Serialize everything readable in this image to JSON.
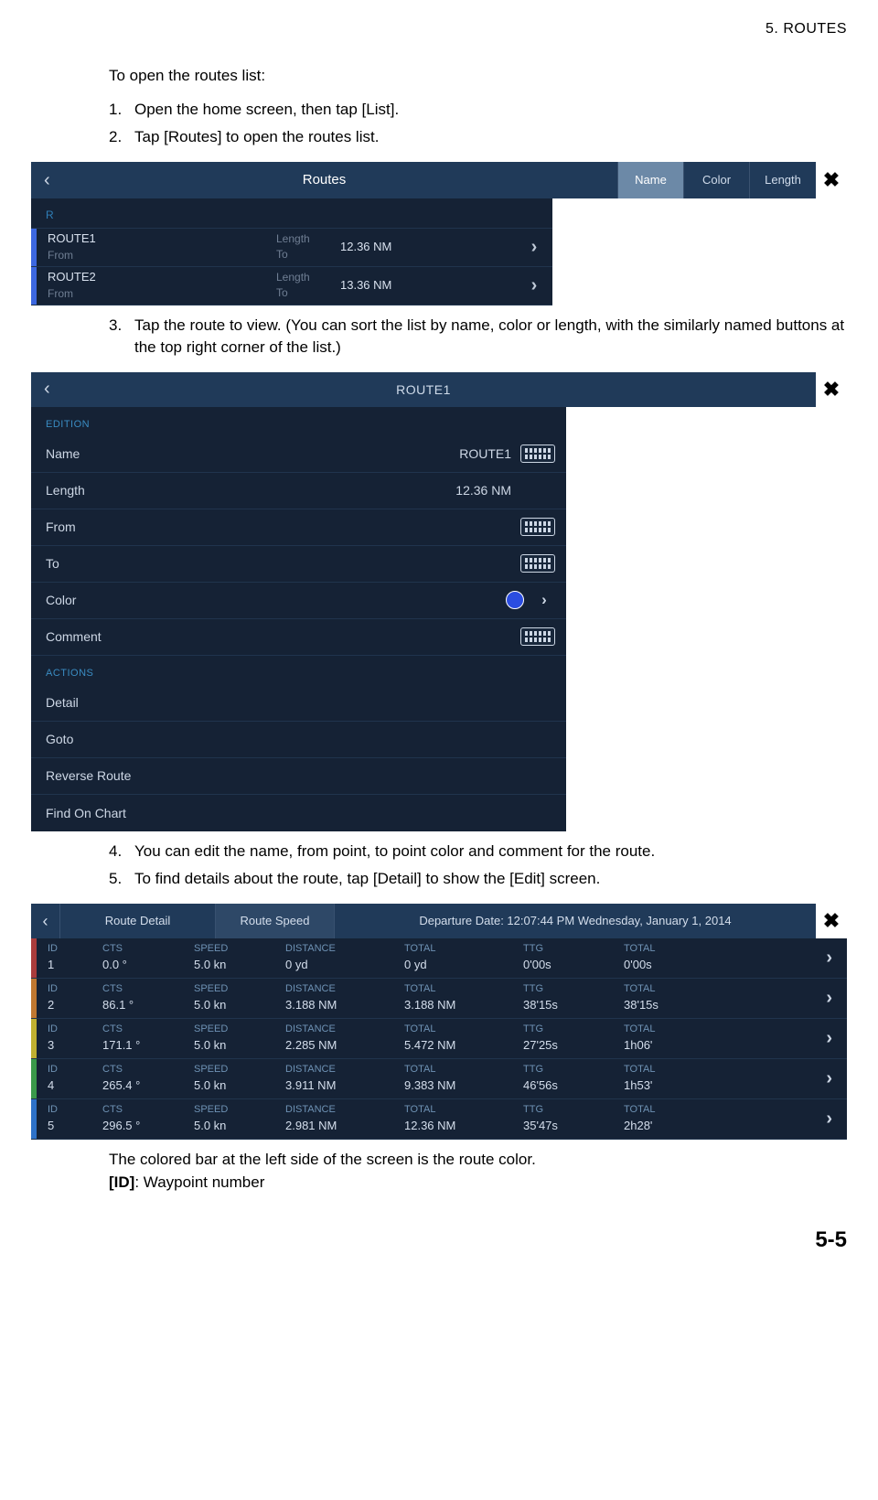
{
  "chapter_header": "5.  ROUTES",
  "intro": "To open the routes list:",
  "step1": "Open the home screen, then tap [List].",
  "step2": "Tap [Routes] to open the routes list.",
  "step3": "Tap the route to view. (You can sort the list by name, color or length, with the similarly named buttons at the top right corner of the list.)",
  "step4": "You can edit the name, from point, to point color and comment for the route.",
  "step5": "To find details about the route, tap [Detail] to show the [Edit] screen.",
  "footer_line1": "The colored bar at the left side of the screen is the route color.",
  "footer_bold": "[ID]",
  "footer_rest": ": Waypoint number",
  "page_num": "5-5",
  "fig1": {
    "title": "Routes",
    "sort_name": "Name",
    "sort_color": "Color",
    "sort_length": "Length",
    "section": "R",
    "length_label": "Length",
    "to_label": "To",
    "from_label": "From",
    "rows": [
      {
        "name": "ROUTE1",
        "length": "12.36 NM"
      },
      {
        "name": "ROUTE2",
        "length": "13.36 NM"
      }
    ]
  },
  "fig2": {
    "title": "ROUTE1",
    "edition": "EDITION",
    "name_label": "Name",
    "name_val": "ROUTE1",
    "length_label": "Length",
    "length_val": "12.36 NM",
    "from_label": "From",
    "to_label": "To",
    "color_label": "Color",
    "comment_label": "Comment",
    "actions": "ACTIONS",
    "detail": "Detail",
    "goto": "Goto",
    "reverse": "Reverse Route",
    "find": "Find On Chart"
  },
  "fig3": {
    "title": "Route Detail",
    "speed_btn": "Route Speed",
    "departure": "Departure Date: 12:07:44 PM Wednesday, January 1, 2014",
    "hdr": {
      "id": "ID",
      "cts": "CTS",
      "speed": "SPEED",
      "distance": "DISTANCE",
      "total": "TOTAL",
      "ttg": "TTG",
      "total2": "TOTAL"
    },
    "rows": [
      {
        "bar": "bar-red",
        "id": "1",
        "cts": "0.0 °",
        "speed": "5.0 kn",
        "dist": "0 yd",
        "tot": "0 yd",
        "ttg": "0'00s",
        "tot2": "0'00s"
      },
      {
        "bar": "bar-orange",
        "id": "2",
        "cts": "86.1 °",
        "speed": "5.0 kn",
        "dist": "3.188 NM",
        "tot": "3.188 NM",
        "ttg": "38'15s",
        "tot2": "38'15s"
      },
      {
        "bar": "bar-yellow",
        "id": "3",
        "cts": "171.1 °",
        "speed": "5.0 kn",
        "dist": "2.285 NM",
        "tot": "5.472 NM",
        "ttg": "27'25s",
        "tot2": "1h06'"
      },
      {
        "bar": "bar-green",
        "id": "4",
        "cts": "265.4 °",
        "speed": "5.0 kn",
        "dist": "3.911 NM",
        "tot": "9.383 NM",
        "ttg": "46'56s",
        "tot2": "1h53'"
      },
      {
        "bar": "bar-blue",
        "id": "5",
        "cts": "296.5 °",
        "speed": "5.0 kn",
        "dist": "2.981 NM",
        "tot": "12.36 NM",
        "ttg": "35'47s",
        "tot2": "2h28'"
      }
    ]
  }
}
